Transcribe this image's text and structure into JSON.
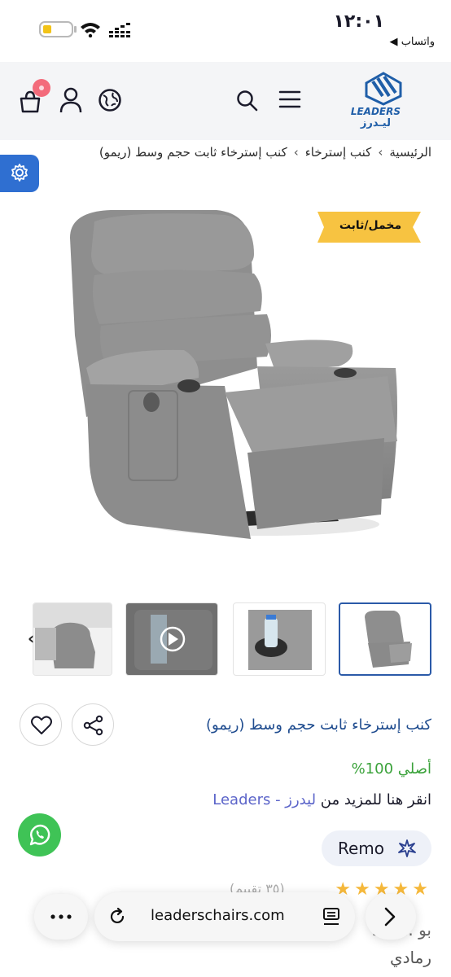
{
  "status": {
    "time": "١٢:٠١",
    "back_label": "◀ واتساب"
  },
  "brand": {
    "logo_en": "LEADERS",
    "logo_ar": "ليـدرز"
  },
  "breadcrumb": [
    "الرئيسية",
    "كنب إسترخاء",
    "كنب إسترخاء ثابت حجم وسط (ريمو)"
  ],
  "product": {
    "tag": "مخمل/ثابت",
    "title": "كنب إسترخاء ثابت حجم وسط (ريمو)",
    "original_label": "أصلي 100%",
    "more_prefix": "انقر هنا للمزيد من",
    "more_brand": "ليدرز - Leaders",
    "variant": "Remo",
    "rating_count": "(٣٥ تقييم)",
    "faded_line": "51 ... بو",
    "color_label": "رمادي"
  },
  "browser": {
    "url": "leaderschairs.com"
  },
  "colors": {
    "accent": "#1f5ea8",
    "tag": "#f7c341",
    "whatsapp": "#3fc356"
  }
}
